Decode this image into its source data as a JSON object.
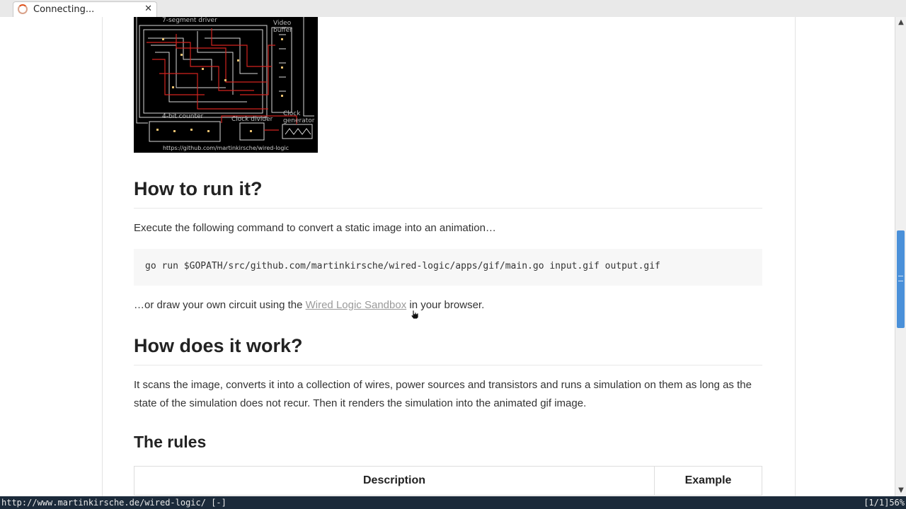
{
  "tab": {
    "title": "Connecting..."
  },
  "circuit": {
    "labels": {
      "segment_driver": "7-segment driver",
      "video_buffer": "Video\nbuffer",
      "bit_counter": "4-bit counter",
      "clock_divider": "Clock divider",
      "clock_generator": "Clock\ngenerator"
    },
    "caption": "https://github.com/martinkirsche/wired-logic"
  },
  "sections": {
    "run": {
      "heading": "How to run it?",
      "intro": "Execute the following command to convert a static image into an animation…",
      "code": "go run $GOPATH/src/github.com/martinkirsche/wired-logic/apps/gif/main.go input.gif output.gif",
      "alt_prefix": "…or draw your own circuit using the ",
      "alt_link": "Wired Logic Sandbox",
      "alt_suffix": " in your browser."
    },
    "work": {
      "heading": "How does it work?",
      "text": "It scans the image, converts it into a collection of wires, power sources and transistors and runs a simulation on them as long as the state of the simulation does not recur. Then it renders the simulation into the animated gif image."
    },
    "rules": {
      "heading": "The rules",
      "columns": [
        "Description",
        "Example"
      ]
    }
  },
  "statusbar": {
    "url": "http://www.martinkirsche.de/wired-logic/ [-]",
    "position": "[1/1]56%"
  }
}
